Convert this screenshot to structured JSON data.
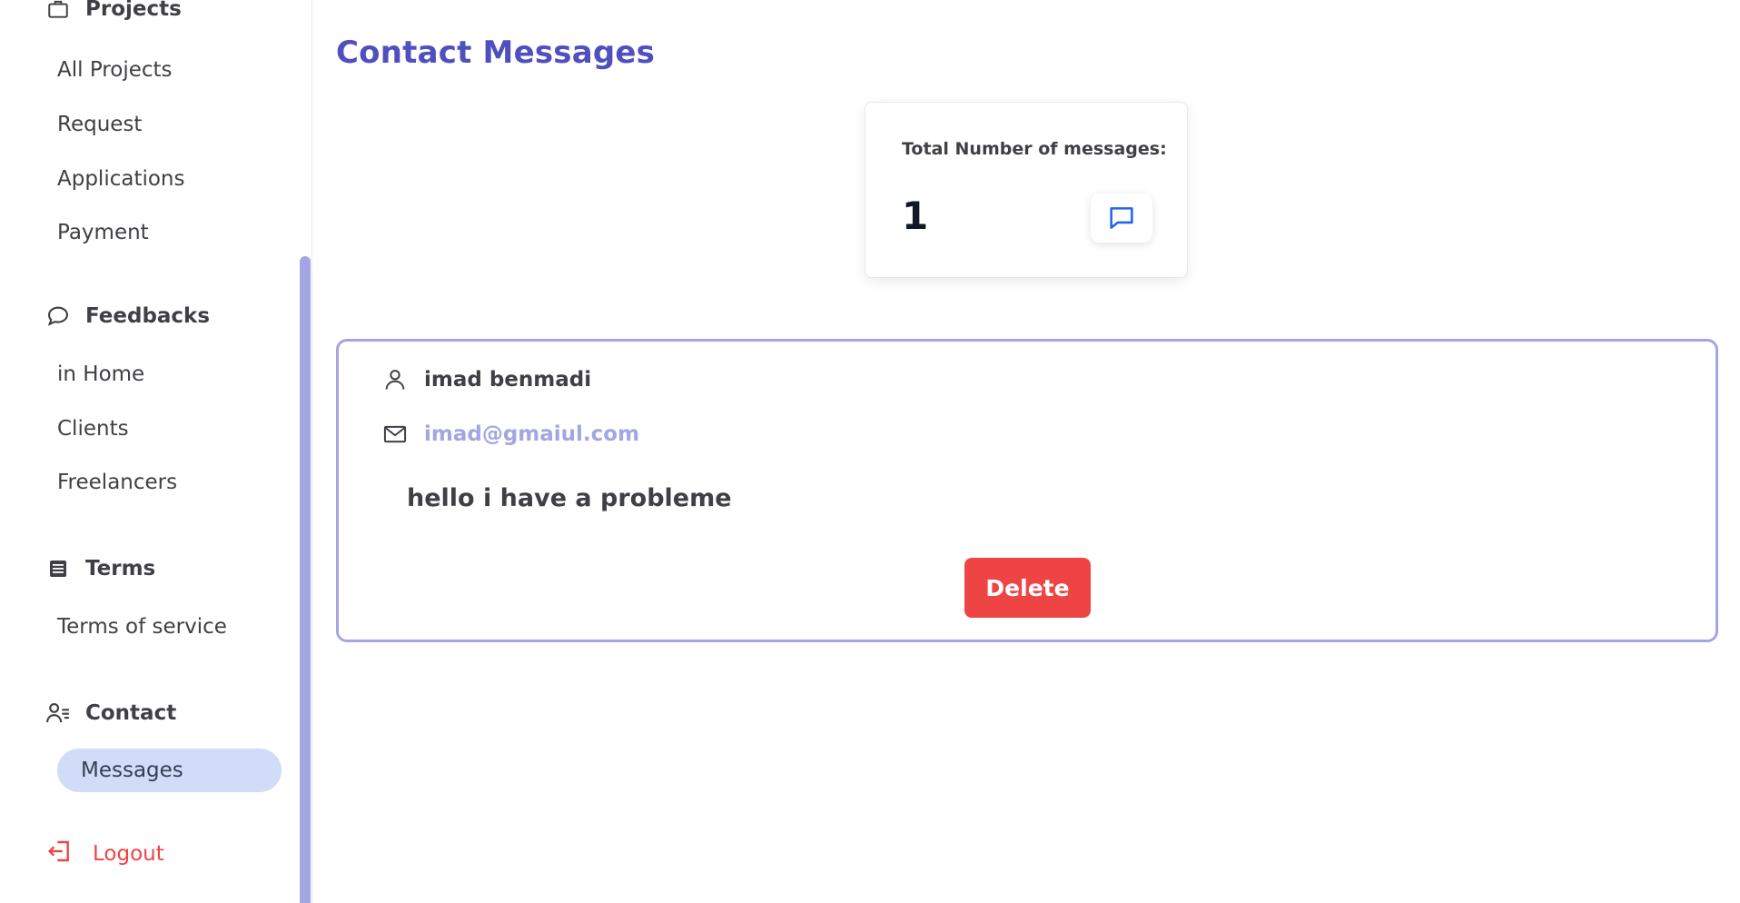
{
  "sidebar": {
    "sections": [
      {
        "title": "Projects",
        "icon": "briefcase-icon",
        "items": [
          "All Projects",
          "Request",
          "Applications",
          "Payment"
        ]
      },
      {
        "title": "Feedbacks",
        "icon": "chat-bubble-icon",
        "items": [
          "in Home",
          "Clients",
          "Freelancers"
        ]
      },
      {
        "title": "Terms",
        "icon": "document-list-icon",
        "items": [
          "Terms of service"
        ]
      },
      {
        "title": "Contact",
        "icon": "contact-user-icon",
        "items": [
          "Messages"
        ]
      }
    ],
    "active_item": "Messages",
    "logout_label": "Logout"
  },
  "main": {
    "title": "Contact Messages",
    "stat": {
      "label": "Total Number of messages:",
      "value": "1",
      "icon": "message-icon"
    },
    "messages": [
      {
        "name": "imad benmadi",
        "email": "imad@gmaiul.com",
        "body": "hello i have a probleme",
        "delete_label": "Delete"
      }
    ]
  },
  "colors": {
    "accent": "#4f4fbf",
    "card_border": "#a3a6e3",
    "active_bg": "#d0dcf8",
    "danger": "#ef4444",
    "message_icon": "#2563eb"
  }
}
